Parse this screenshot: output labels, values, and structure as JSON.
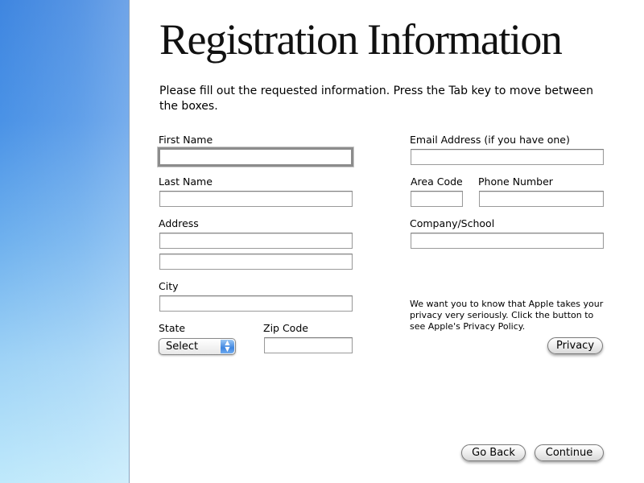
{
  "page": {
    "title": "Registration Information",
    "intro": "Please fill out the requested information. Press the Tab key to move between the boxes.",
    "privacy_note": "We want you to know that Apple takes your privacy very seriously. Click the button to see Apple's Privacy Policy."
  },
  "form": {
    "first_name": {
      "label": "First Name",
      "value": ""
    },
    "last_name": {
      "label": "Last Name",
      "value": ""
    },
    "address": {
      "label": "Address",
      "line1": "",
      "line2": ""
    },
    "city": {
      "label": "City",
      "value": ""
    },
    "state": {
      "label": "State",
      "selected": "Select"
    },
    "zip": {
      "label": "Zip Code",
      "value": ""
    },
    "email": {
      "label": "Email Address (if you have one)",
      "value": ""
    },
    "area_code": {
      "label": "Area Code",
      "value": ""
    },
    "phone": {
      "label": "Phone Number",
      "value": ""
    },
    "company": {
      "label": "Company/School",
      "value": ""
    }
  },
  "buttons": {
    "privacy": "Privacy",
    "go_back": "Go Back",
    "continue": "Continue"
  },
  "focused_field": "first_name",
  "icons": {
    "select_arrows": "up-down-arrows-icon"
  },
  "colors": {
    "sidebar_top": "#3f86e0",
    "sidebar_bottom": "#bfe9fb",
    "select_accent": "#3f86e0"
  }
}
